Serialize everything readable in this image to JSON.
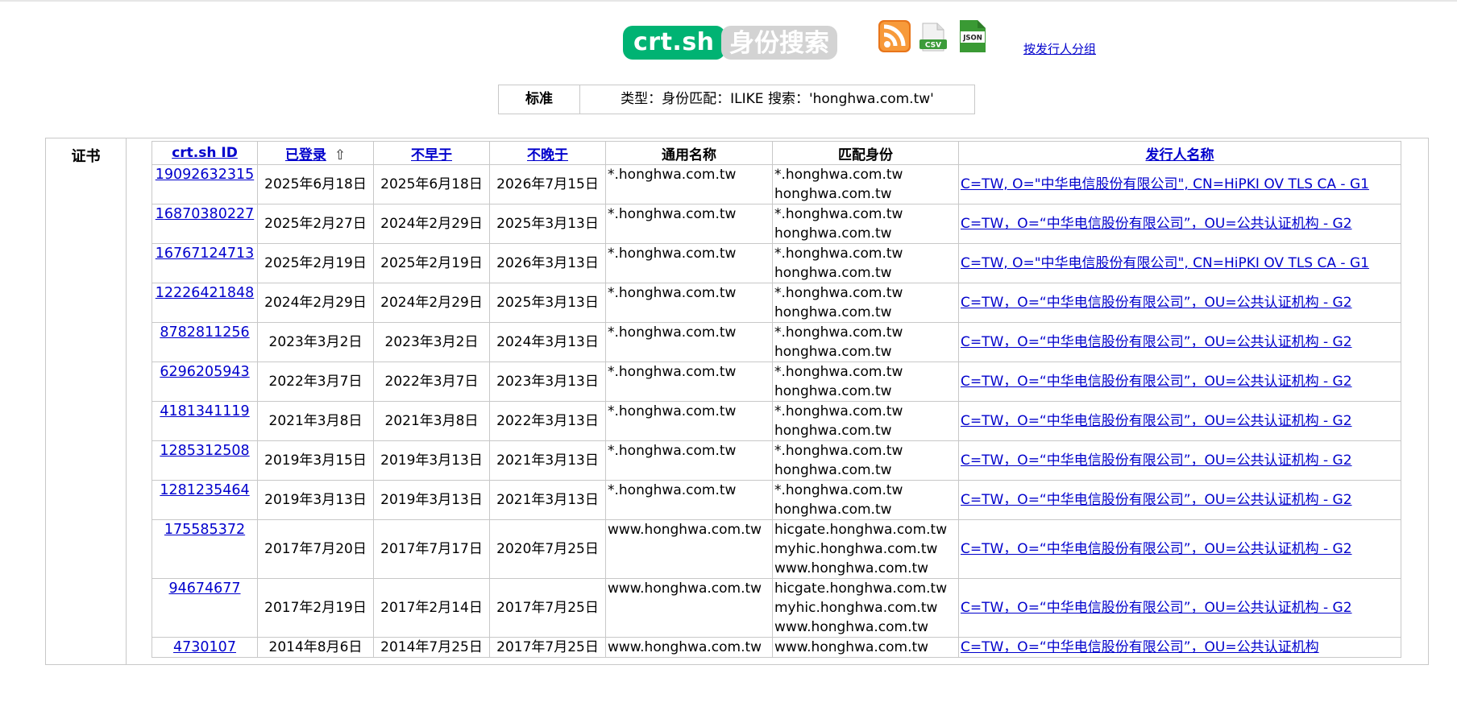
{
  "header": {
    "brand": "crt.sh",
    "subtitle": "身份搜索",
    "feeds": [
      {
        "label": "RSS",
        "icon": "rss-icon",
        "color": "#f3902d"
      },
      {
        "label": "CSV",
        "icon": "csv-file-icon",
        "color": "#4aa646"
      },
      {
        "label": "JSON",
        "icon": "json-file-icon",
        "color": "#3a8c2f"
      }
    ],
    "group_link": "按发行人分组"
  },
  "criteria": {
    "label": "标准",
    "value": "类型：身份匹配：ILIKE 搜索：'honghwa.com.tw'"
  },
  "section_label": "证书",
  "table": {
    "columns": [
      "crt.sh ID",
      "已登录",
      "不早于",
      "不晚于",
      "通用名称",
      "匹配身份",
      "发行人名称"
    ],
    "sort_arrow": "⇧",
    "rows": [
      {
        "id": "19092632315",
        "logged": "2025年6月18日",
        "not_before": "2025年6月18日",
        "not_after": "2026年7月15日",
        "cn": "*.honghwa.com.tw",
        "identities": [
          "*.honghwa.com.tw",
          "honghwa.com.tw"
        ],
        "issuer": "C=TW, O=\"中华电信股份有限公司\", CN=HiPKI OV TLS CA - G1"
      },
      {
        "id": "16870380227",
        "logged": "2025年2月27日",
        "not_before": "2024年2月29日",
        "not_after": "2025年3月13日",
        "cn": "*.honghwa.com.tw",
        "identities": [
          "*.honghwa.com.tw",
          "honghwa.com.tw"
        ],
        "issuer": "C=TW，O=“中华电信股份有限公司”，OU=公共认证机构 - G2"
      },
      {
        "id": "16767124713",
        "logged": "2025年2月19日",
        "not_before": "2025年2月19日",
        "not_after": "2026年3月13日",
        "cn": "*.honghwa.com.tw",
        "identities": [
          "*.honghwa.com.tw",
          "honghwa.com.tw"
        ],
        "issuer": "C=TW, O=\"中华电信股份有限公司\", CN=HiPKI OV TLS CA - G1"
      },
      {
        "id": "12226421848",
        "logged": "2024年2月29日",
        "not_before": "2024年2月29日",
        "not_after": "2025年3月13日",
        "cn": "*.honghwa.com.tw",
        "identities": [
          "*.honghwa.com.tw",
          "honghwa.com.tw"
        ],
        "issuer": "C=TW，O=“中华电信股份有限公司”，OU=公共认证机构 - G2"
      },
      {
        "id": "8782811256",
        "logged": "2023年3月2日",
        "not_before": "2023年3月2日",
        "not_after": "2024年3月13日",
        "cn": "*.honghwa.com.tw",
        "identities": [
          "*.honghwa.com.tw",
          "honghwa.com.tw"
        ],
        "issuer": "C=TW，O=“中华电信股份有限公司”，OU=公共认证机构 - G2"
      },
      {
        "id": "6296205943",
        "logged": "2022年3月7日",
        "not_before": "2022年3月7日",
        "not_after": "2023年3月13日",
        "cn": "*.honghwa.com.tw",
        "identities": [
          "*.honghwa.com.tw",
          "honghwa.com.tw"
        ],
        "issuer": "C=TW，O=“中华电信股份有限公司”，OU=公共认证机构 - G2"
      },
      {
        "id": "4181341119",
        "logged": "2021年3月8日",
        "not_before": "2021年3月8日",
        "not_after": "2022年3月13日",
        "cn": "*.honghwa.com.tw",
        "identities": [
          "*.honghwa.com.tw",
          "honghwa.com.tw"
        ],
        "issuer": "C=TW，O=“中华电信股份有限公司”，OU=公共认证机构 - G2"
      },
      {
        "id": "1285312508",
        "logged": "2019年3月15日",
        "not_before": "2019年3月13日",
        "not_after": "2021年3月13日",
        "cn": "*.honghwa.com.tw",
        "identities": [
          "*.honghwa.com.tw",
          "honghwa.com.tw"
        ],
        "issuer": "C=TW，O=“中华电信股份有限公司”，OU=公共认证机构 - G2"
      },
      {
        "id": "1281235464",
        "logged": "2019年3月13日",
        "not_before": "2019年3月13日",
        "not_after": "2021年3月13日",
        "cn": "*.honghwa.com.tw",
        "identities": [
          "*.honghwa.com.tw",
          "honghwa.com.tw"
        ],
        "issuer": "C=TW，O=“中华电信股份有限公司”，OU=公共认证机构 - G2"
      },
      {
        "id": "175585372",
        "logged": "2017年7月20日",
        "not_before": "2017年7月17日",
        "not_after": "2020年7月25日",
        "cn": "www.honghwa.com.tw",
        "identities": [
          "hicgate.honghwa.com.tw",
          "myhic.honghwa.com.tw",
          "www.honghwa.com.tw"
        ],
        "issuer": "C=TW，O=“中华电信股份有限公司”，OU=公共认证机构 - G2"
      },
      {
        "id": "94674677",
        "logged": "2017年2月19日",
        "not_before": "2017年2月14日",
        "not_after": "2017年7月25日",
        "cn": "www.honghwa.com.tw",
        "identities": [
          "hicgate.honghwa.com.tw",
          "myhic.honghwa.com.tw",
          "www.honghwa.com.tw"
        ],
        "issuer": "C=TW，O=“中华电信股份有限公司”，OU=公共认证机构 - G2"
      },
      {
        "id": "4730107",
        "logged": "2014年8月6日",
        "not_before": "2014年7月25日",
        "not_after": "2017年7月25日",
        "cn": "www.honghwa.com.tw",
        "identities": [
          "www.honghwa.com.tw"
        ],
        "issuer": "C=TW，O=“中华电信股份有限公司”，OU=公共认证机构"
      }
    ]
  }
}
